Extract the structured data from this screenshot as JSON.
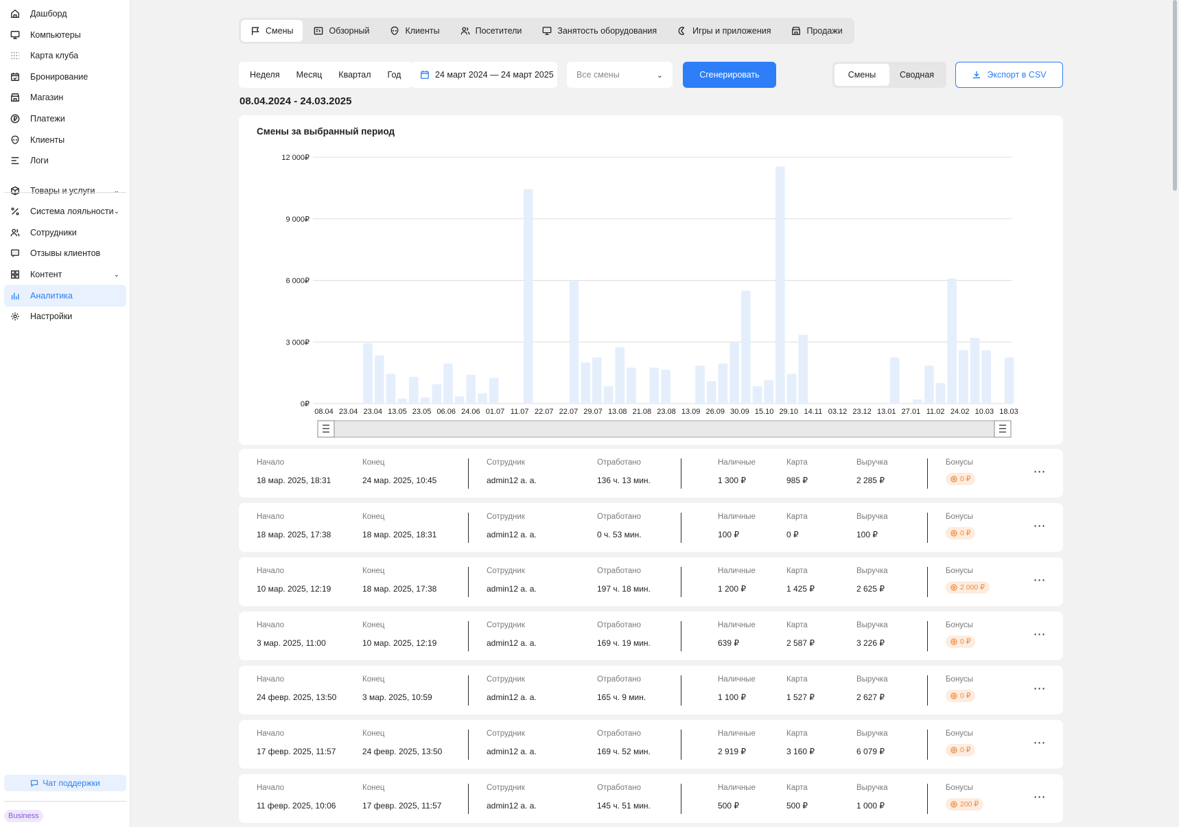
{
  "sidebar": {
    "items": [
      {
        "label": "Дашборд",
        "icon": "home-icon"
      },
      {
        "label": "Компьютеры",
        "icon": "monitor-icon"
      },
      {
        "label": "Карта клуба",
        "icon": "grid-dots-icon"
      },
      {
        "label": "Бронирование",
        "icon": "calendar-check-icon"
      },
      {
        "label": "Магазин",
        "icon": "store-icon"
      },
      {
        "label": "Платежи",
        "icon": "ruble-coin-icon"
      },
      {
        "label": "Клиенты",
        "icon": "alien-head-icon"
      },
      {
        "label": "Логи",
        "icon": "lines-icon"
      },
      {
        "label": "Товары и услуги",
        "icon": "box-icon"
      },
      {
        "label": "Система лояльности",
        "icon": "percent-icon"
      },
      {
        "label": "Сотрудники",
        "icon": "users-icon"
      },
      {
        "label": "Отзывы клиентов",
        "icon": "message-icon"
      },
      {
        "label": "Контент",
        "icon": "widgets-icon"
      },
      {
        "label": "Аналитика",
        "icon": "bar-chart-icon",
        "active": true
      },
      {
        "label": "Настройки",
        "icon": "gear-icon"
      }
    ],
    "support_label": "Чат поддержки",
    "plan_badge": "Business"
  },
  "tabs": [
    {
      "label": "Смены",
      "icon": "flag-icon",
      "active": true
    },
    {
      "label": "Обзорный",
      "icon": "dashboard-card-icon"
    },
    {
      "label": "Клиенты",
      "icon": "alien-head-icon"
    },
    {
      "label": "Посетители",
      "icon": "users-icon"
    },
    {
      "label": "Занятость оборудования",
      "icon": "monitor-icon"
    },
    {
      "label": "Игры и приложения",
      "icon": "game-icon"
    },
    {
      "label": "Продажи",
      "icon": "store-icon"
    }
  ],
  "filters": {
    "periods": [
      "Неделя",
      "Месяц",
      "Квартал",
      "Год"
    ],
    "date_range": "24 март 2024 — 24 март 2025",
    "shift_select_placeholder": "Все смены",
    "generate_label": "Сгенерировать",
    "view_options": [
      "Смены",
      "Сводная"
    ],
    "export_label": "Экспорт в CSV"
  },
  "period_title": "08.04.2024 - 24.03.2025",
  "chart_title": "Смены за выбранный период",
  "colors": {
    "accent": "#2d7ef7",
    "bar": "#e5effc",
    "bonus": "#f08a3a"
  },
  "chart_data": {
    "type": "bar",
    "title": "Смены за выбранный период",
    "ylim": [
      0,
      12000
    ],
    "y_ticks": [
      "0₽",
      "3 000₽",
      "6 000₽",
      "9 000₽",
      "12 000₽"
    ],
    "x_tick_labels": [
      "08.04",
      "23.04",
      "23.04",
      "13.05",
      "23.05",
      "06.06",
      "24.06",
      "01.07",
      "11.07",
      "22.07",
      "22.07",
      "29.07",
      "13.08",
      "21.08",
      "23.08",
      "13.09",
      "26.09",
      "30.09",
      "15.10",
      "29.10",
      "14.11",
      "03.12",
      "23.12",
      "13.01",
      "27.01",
      "11.02",
      "24.02",
      "10.03",
      "18.03"
    ],
    "values": [
      0,
      0,
      0,
      0,
      2950,
      2350,
      1450,
      250,
      1300,
      300,
      950,
      1950,
      350,
      1400,
      500,
      1250,
      0,
      0,
      10450,
      0,
      0,
      0,
      6000,
      2000,
      2250,
      850,
      2750,
      1750,
      0,
      1750,
      1650,
      0,
      0,
      1850,
      1100,
      1950,
      3000,
      5500,
      850,
      1150,
      11550,
      1450,
      3350,
      0,
      0,
      0,
      0,
      0,
      0,
      0,
      2250,
      0,
      200,
      1850,
      1000,
      6100,
      2600,
      3200,
      2600,
      0,
      2250
    ]
  },
  "shift_labels": {
    "start": "Начало",
    "end": "Конец",
    "employee": "Сотрудник",
    "worked": "Отработано",
    "cash": "Наличные",
    "card": "Карта",
    "revenue": "Выручка",
    "bonuses": "Бонусы"
  },
  "shifts": [
    {
      "start": "18 мар. 2025, 18:31",
      "end": "24 мар. 2025, 10:45",
      "employee": "admin12 а. а.",
      "worked": "136 ч. 13 мин.",
      "cash": "1 300 ₽",
      "card": "985 ₽",
      "revenue": "2 285 ₽",
      "bonus": "0 ₽"
    },
    {
      "start": "18 мар. 2025, 17:38",
      "end": "18 мар. 2025, 18:31",
      "employee": "admin12 а. а.",
      "worked": "0 ч. 53 мин.",
      "cash": "100 ₽",
      "card": "0 ₽",
      "revenue": "100 ₽",
      "bonus": "0 ₽"
    },
    {
      "start": "10 мар. 2025, 12:19",
      "end": "18 мар. 2025, 17:38",
      "employee": "admin12 а. а.",
      "worked": "197 ч. 18 мин.",
      "cash": "1 200 ₽",
      "card": "1 425 ₽",
      "revenue": "2 625 ₽",
      "bonus": "2 000 ₽"
    },
    {
      "start": "3 мар. 2025, 11:00",
      "end": "10 мар. 2025, 12:19",
      "employee": "admin12 а. а.",
      "worked": "169 ч. 19 мин.",
      "cash": "639 ₽",
      "card": "2 587 ₽",
      "revenue": "3 226 ₽",
      "bonus": "0 ₽"
    },
    {
      "start": "24 февр. 2025, 13:50",
      "end": "3 мар. 2025, 10:59",
      "employee": "admin12 а. а.",
      "worked": "165 ч. 9 мин.",
      "cash": "1 100 ₽",
      "card": "1 527 ₽",
      "revenue": "2 627 ₽",
      "bonus": "0 ₽"
    },
    {
      "start": "17 февр. 2025, 11:57",
      "end": "24 февр. 2025, 13:50",
      "employee": "admin12 а. а.",
      "worked": "169 ч. 52 мин.",
      "cash": "2 919 ₽",
      "card": "3 160 ₽",
      "revenue": "6 079 ₽",
      "bonus": "0 ₽"
    },
    {
      "start": "11 февр. 2025, 10:06",
      "end": "17 февр. 2025, 11:57",
      "employee": "admin12 а. а.",
      "worked": "145 ч. 51 мин.",
      "cash": "500 ₽",
      "card": "500 ₽",
      "revenue": "1 000 ₽",
      "bonus": "200 ₽"
    }
  ]
}
